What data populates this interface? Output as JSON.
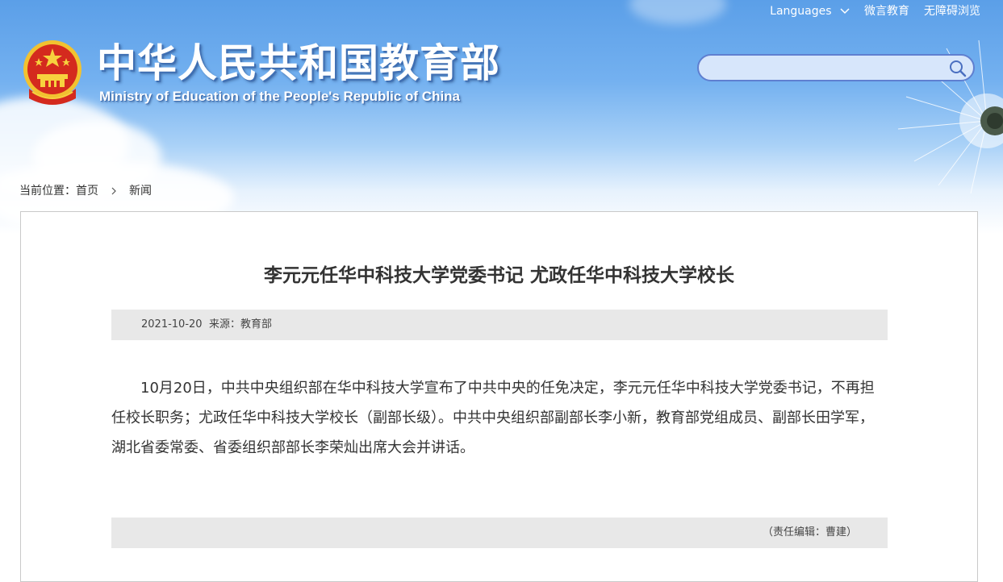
{
  "top_links": {
    "languages": "Languages",
    "weixin": "微言教育",
    "accessibility": "无障碍浏览"
  },
  "logo": {
    "title": "中华人民共和国教育部",
    "subtitle": "Ministry of Education of the People's Republic of China"
  },
  "search": {
    "placeholder": "",
    "value": ""
  },
  "breadcrumb": {
    "prefix": "当前位置：",
    "home": "首页",
    "current": "新闻"
  },
  "article": {
    "title": "李元元任华中科技大学党委书记 尤政任华中科技大学校长",
    "date": "2021-10-20",
    "source": "来源：教育部",
    "body": "10月20日，中共中央组织部在华中科技大学宣布了中共中央的任免决定，李元元任华中科技大学党委书记，不再担任校长职务；尤政任华中科技大学校长（副部长级）。中共中央组织部副部长李小新，教育部党组成员、副部长田学军，湖北省委常委、省委组织部部长李荣灿出席大会并讲话。",
    "editor": "（责任编辑：曹建）"
  },
  "colors": {
    "header_top": "#5b9fe8",
    "search_border": "#5f7fd0",
    "meta_bar": "#e8e8e8",
    "text": "#333333"
  }
}
